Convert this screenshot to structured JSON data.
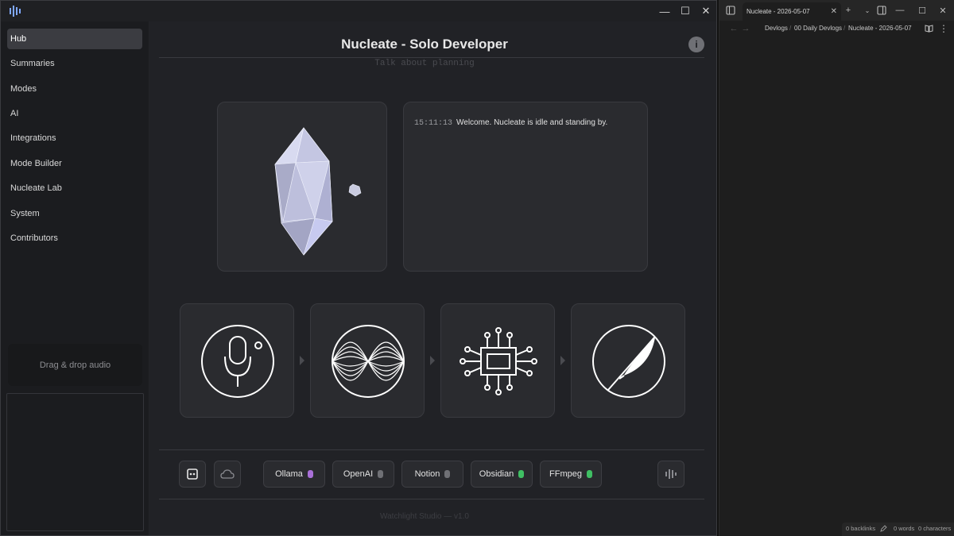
{
  "app": {
    "logo_icon": "app-bars-logo-icon"
  },
  "window_controls": {
    "minimize": "—",
    "maximize": "☐",
    "close": "✕"
  },
  "sidebar": {
    "items": [
      {
        "label": "Hub",
        "active": true
      },
      {
        "label": "Summaries",
        "active": false
      },
      {
        "label": "Modes",
        "active": false
      },
      {
        "label": "AI",
        "active": false
      },
      {
        "label": "Integrations",
        "active": false
      },
      {
        "label": "Mode Builder",
        "active": false
      },
      {
        "label": "Nucleate Lab",
        "active": false
      },
      {
        "label": "System",
        "active": false
      },
      {
        "label": "Contributors",
        "active": false
      }
    ],
    "dropzone_label": "Drag & drop audio"
  },
  "main": {
    "title": "Nucleate - Solo Developer",
    "subtitle": "Talk about planning",
    "info_label": "i",
    "log": {
      "time": "15:11:13",
      "message": "Welcome. Nucleate is idle and standing by."
    },
    "pipeline": [
      "microphone-icon",
      "waveform-icon",
      "processor-chip-icon",
      "quill-pen-icon"
    ],
    "integrations": [
      {
        "label": "Ollama",
        "color": "#a970d8"
      },
      {
        "label": "OpenAI",
        "color": "#6f7075"
      },
      {
        "label": "Notion",
        "color": "#6f7075"
      },
      {
        "label": "Obsidian",
        "color": "#3fbf63"
      },
      {
        "label": "FFmpeg",
        "color": "#3fbf63"
      }
    ],
    "footer": "Watchlight Studio — v1.0"
  },
  "obsidian": {
    "tab_title": "Nucleate - 2026-05-07",
    "tab_close": "✕",
    "new_tab": "+",
    "breadcrumb": [
      "Devlogs",
      "00 Daily Devlogs",
      "Nucleate - 2026-05-07"
    ],
    "breadcrumb_sep": "/",
    "status": {
      "backlinks": "0 backlinks",
      "words": "0 words",
      "characters": "0 characters"
    }
  },
  "colors": {
    "accent_purple": "#a970d8",
    "status_green": "#3fbf63",
    "status_gray": "#6f7075"
  }
}
